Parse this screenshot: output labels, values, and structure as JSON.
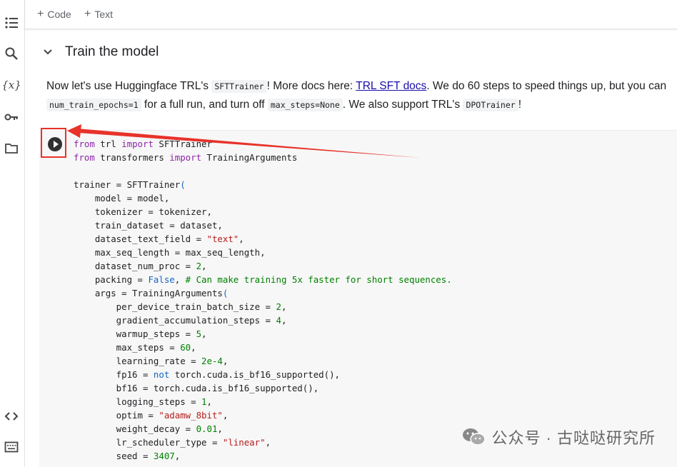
{
  "toolbar": {
    "add_code_label": "Code",
    "add_text_label": "Text"
  },
  "section": {
    "title": "Train the model"
  },
  "text_cell": {
    "part1": "Now let's use Huggingface TRL's ",
    "code1": "SFTTrainer",
    "part2": "! More docs here: ",
    "link": "TRL SFT docs",
    "part3": ". We do 60 steps to speed things up, but you can",
    "code2": "num_train_epochs=1",
    "part4": " for a full run, and turn off ",
    "code3": "max_steps=None",
    "part5": ". We also support TRL's ",
    "code4": "DPOTrainer",
    "part6": "!"
  },
  "watermark": {
    "text": "公众号 · 古哒哒研究所"
  },
  "colors": {
    "annotation_red": "#e8322a",
    "keyword_purple": "#8e24aa",
    "string_red": "#b71c1c",
    "number_green": "#008000"
  },
  "icons": [
    "toc-icon",
    "search-icon",
    "variables-icon",
    "key-icon",
    "folder-icon",
    "code-brackets-icon",
    "terminal-icon",
    "run-icon"
  ]
}
